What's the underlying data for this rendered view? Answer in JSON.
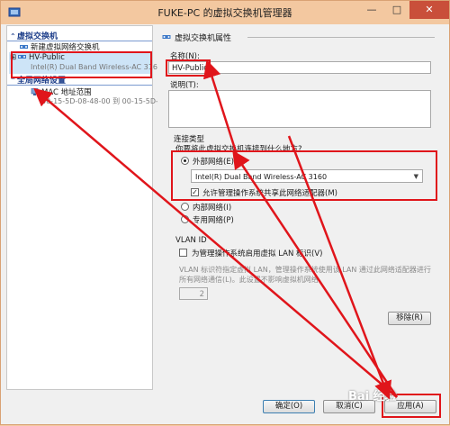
{
  "window": {
    "title": "FUKE-PC 的虚拟交换机管理器",
    "controls": {
      "minimize": "—",
      "maximize": "□",
      "close": "✕"
    }
  },
  "sidebar": {
    "section_switches": "虚拟交换机",
    "new_switch": "新建虚拟网络交换机",
    "switch_name": "HV-Public",
    "switch_adapter": "Intel(R) Dual Band Wireless-AC 3160",
    "section_global": "全局网络设置",
    "mac_title": "MAC 地址范围",
    "mac_range": "00-15-5D-08-48-00 到 00-15-5D-..."
  },
  "properties": {
    "group_title": "虚拟交换机属性",
    "name_label": "名称(N):",
    "name_value": "HV-Public",
    "notes_label": "说明(T):",
    "conn_type_label": "连接类型",
    "conn_question": "你要将此虚拟交换机连接到什么地方?",
    "external_label": "外部网络(E):",
    "adapter_value": "Intel(R) Dual Band Wireless-AC 3160",
    "allow_mgmt_label": "允许管理操作系统共享此网络适配器(M)",
    "internal_label": "内部网络(I)",
    "private_label": "专用网络(P)",
    "vlan_title": "VLAN ID",
    "vlan_enable_label": "为管理操作系统启用虚拟 LAN 标识(V)",
    "vlan_desc": "VLAN 标识符指定虚拟 LAN，管理操作系统使用该 LAN 通过此网络适配器进行所有网络通信(L)。此设置不影响虚拟机网络。",
    "vlan_value": "2",
    "remove_label": "移除(R)"
  },
  "footer": {
    "ok_label": "确定(O)",
    "cancel_label": "取消(C)",
    "apply_label": "应用(A)"
  },
  "watermark": "Bai 经验",
  "annotation_color": "#e0151b"
}
